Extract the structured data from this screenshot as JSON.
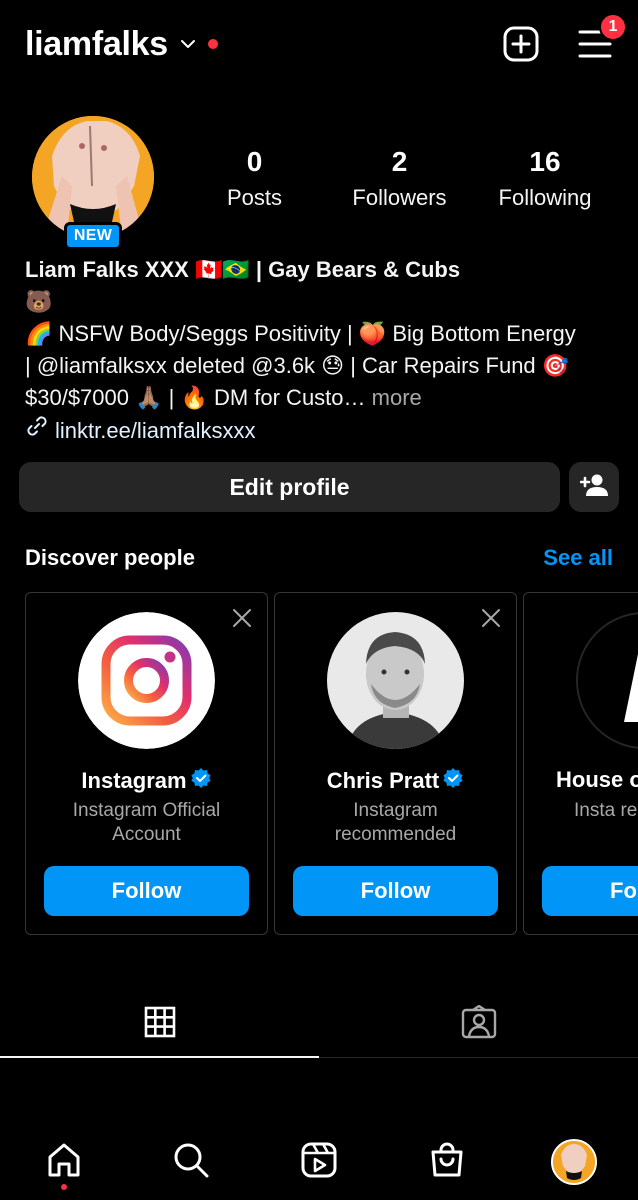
{
  "header": {
    "username": "liamfalks",
    "notification_count": "1",
    "icons": [
      "chevron-down-icon",
      "create-plus-icon",
      "menu-icon"
    ],
    "accent": "#ff3040"
  },
  "profile": {
    "new_badge": "NEW",
    "stats": [
      {
        "value": "0",
        "label": "Posts"
      },
      {
        "value": "2",
        "label": "Followers"
      },
      {
        "value": "16",
        "label": "Following"
      }
    ],
    "bio": {
      "name_line": "Liam Falks XXX 🇨🇦🇧🇷 | Gay Bears & Cubs",
      "line2": "🐻",
      "line3": "🌈 NSFW Body/Seggs Positivity | 🍑 Big Bottom Energy",
      "line4": "| @liamfalksxx deleted @3.6k 😓 | Car Repairs Fund 🎯",
      "line5": "$30/$7000 🙏🏽 | 🔥 DM for Custo…",
      "more": "more",
      "link": "linktr.ee/liamfalksxxx"
    },
    "edit_button": "Edit profile"
  },
  "discover": {
    "title": "Discover people",
    "see_all": "See all",
    "cards": [
      {
        "name": "Instagram",
        "verified": true,
        "subtitle": "Instagram Official Account",
        "button": "Follow"
      },
      {
        "name": "Chris Pratt",
        "verified": true,
        "subtitle": "Instagram recommended",
        "button": "Follow"
      },
      {
        "name": "House o",
        "verified": false,
        "subtitle": "Insta recomm",
        "button": "Fol"
      }
    ]
  },
  "tabs": [
    {
      "icon": "grid-icon",
      "active": true
    },
    {
      "icon": "tagged-icon",
      "active": false
    }
  ],
  "bottom_nav": [
    {
      "icon": "home-icon",
      "active": true
    },
    {
      "icon": "search-icon"
    },
    {
      "icon": "reels-icon"
    },
    {
      "icon": "shop-icon"
    },
    {
      "icon": "profile-avatar"
    }
  ],
  "colors": {
    "background": "#000000",
    "button": "#262626",
    "primary_blue": "#0095f6",
    "muted": "#a8a8a8"
  }
}
